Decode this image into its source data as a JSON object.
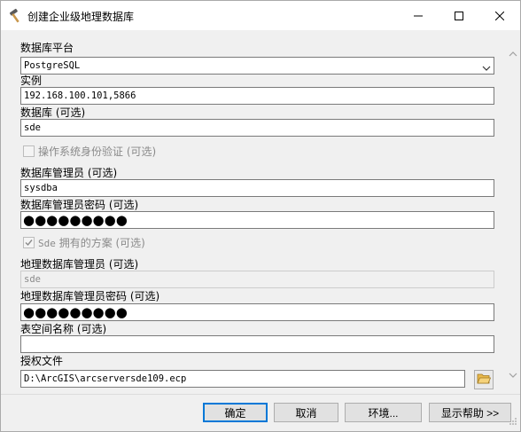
{
  "window": {
    "title": "创建企业级地理数据库",
    "app_icon": "hammer-icon",
    "controls": [
      "minimize-icon",
      "maximize-icon",
      "close-icon"
    ]
  },
  "form": {
    "platform_label": "数据库平台",
    "platform_value": "PostgreSQL",
    "instance_label": "实例",
    "instance_value": "192.168.100.101,5866",
    "database_label": "数据库 (可选)",
    "database_value": "sde",
    "os_auth_label": "操作系统身份验证 (可选)",
    "os_auth_checked": false,
    "db_admin_label": "数据库管理员 (可选)",
    "db_admin_value": "sysdba",
    "db_admin_password_label": "数据库管理员密码 (可选)",
    "db_admin_password_value": "●●●●●●●●●",
    "sde_schema_label_prefix": "Sde",
    "sde_schema_label_rest": " 拥有的方案 (可选)",
    "sde_schema_checked": true,
    "gdb_admin_label": "地理数据库管理员 (可选)",
    "gdb_admin_value": "sde",
    "gdb_admin_password_label": "地理数据库管理员密码 (可选)",
    "gdb_admin_password_value": "●●●●●●●●●",
    "tablespace_label": "表空间名称 (可选)",
    "tablespace_value": "",
    "license_label": "授权文件",
    "license_value": "D:\\ArcGIS\\arcserversde109.ecp"
  },
  "buttons": {
    "ok": "确定",
    "cancel": "取消",
    "environments": "环境...",
    "show_help": "显示帮助 >>"
  },
  "colors": {
    "accent": "#0078d7",
    "window_bg": "#f0f0f0",
    "disabled_text": "#8a8a8a"
  }
}
